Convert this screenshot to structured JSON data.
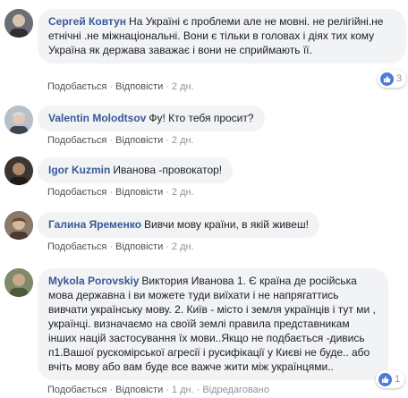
{
  "comments": [
    {
      "author": "Сергей Ковтун",
      "text": "На Україні є проблеми але не мовні. не релігійні.не етнічні .не міжнаціональні. Вони є тільки в головах і діях тих кому Україна як держава заважає і вони не сприймають її.",
      "actions": [
        "Подобається",
        "Відповісти"
      ],
      "time": "2 дн.",
      "reaction_count": "3",
      "avatar_color": "#6b6f75"
    },
    {
      "author": "Valentin Molodtsov",
      "text": "Фу! Кто тебя просит?",
      "actions": [
        "Подобається",
        "Відповісти"
      ],
      "time": "2 дн.",
      "avatar_color": "#8d97a3"
    },
    {
      "author": "Igor Kuzmin",
      "text": "Иванова -провокатор!",
      "actions": [
        "Подобається",
        "Відповісти"
      ],
      "time": "2 дн.",
      "avatar_color": "#5a4a3e"
    },
    {
      "author": "Галина Яременко",
      "text": "Вивчи мову країни, в якій живеш!",
      "actions": [
        "Подобається",
        "Відповісти"
      ],
      "time": "2 дн.",
      "avatar_color": "#7a6a5e"
    },
    {
      "author": "Mykola Porovskiy",
      "text": "Виктория Иванова 1. Є країна де російська мова державна і ви можете туди виїхати і не напрягаттись вивчати українську мову. 2. Київ - місто і земля українців і тут ми , українці. визначаємо на своїй землі правила представникам інших націй застосування їх мови..Якщо не подбається -дивись п1.Вашої рускомірської агресії і русифікації у Києві не буде.. або вчіть мову або вам буде все важче жити між українцями..",
      "actions": [
        "Подобається",
        "Відповісти"
      ],
      "time": "1 дн.",
      "edited": "Відредаговано",
      "reaction_count": "1",
      "avatar_color": "#6d7a5a"
    }
  ],
  "colors": {
    "author": "#385898",
    "bubble": "#f2f3f5",
    "like": "#4b7bd6",
    "meta": "#90949c"
  }
}
